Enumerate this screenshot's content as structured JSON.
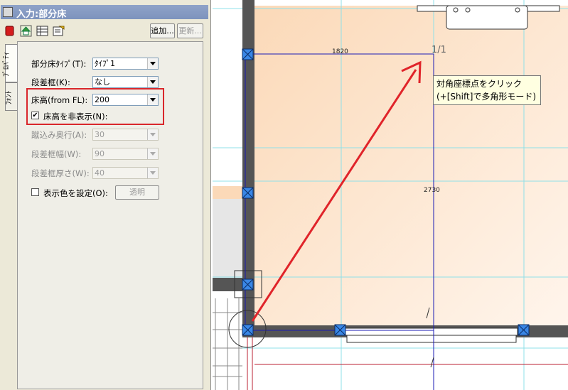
{
  "window": {
    "title": "入力:部分床"
  },
  "toolbar": {
    "add_label": "追加...",
    "update_label": "更新..."
  },
  "tabs": [
    {
      "label": "ﾌﾟﾛﾊﾟﾃｨ"
    },
    {
      "label": "ﾌｫﾝﾄ"
    }
  ],
  "properties": {
    "floor_type": {
      "label": "部分床ﾀｲﾌﾟ(T):",
      "value": "ﾀｲﾌﾟ1"
    },
    "step_frame": {
      "label": "段差框(K):",
      "value": "なし"
    },
    "floor_height": {
      "label": "床高(from FL):",
      "value": "200"
    },
    "hide_floor_height": {
      "label": "床高を非表示(N):",
      "checked": true
    },
    "tread_depth": {
      "label": "蹴込み奥行(A):",
      "value": "30"
    },
    "frame_width": {
      "label": "段差框幅(W):",
      "value": "90"
    },
    "frame_thickness": {
      "label": "段差框厚さ(W):",
      "value": "40"
    },
    "display_color": {
      "label": "表示色を設定(O):",
      "checked": false,
      "button_label": "透明"
    }
  },
  "drawing": {
    "dim_top": "1820",
    "dim_right": "2730",
    "page_label": "1/1",
    "accent_color": "#e0242a",
    "floor_color": "#fde2c8"
  },
  "tooltip": {
    "line1": "対角座標点をクリック",
    "line2": "(+[Shift]で多角形モード)"
  }
}
